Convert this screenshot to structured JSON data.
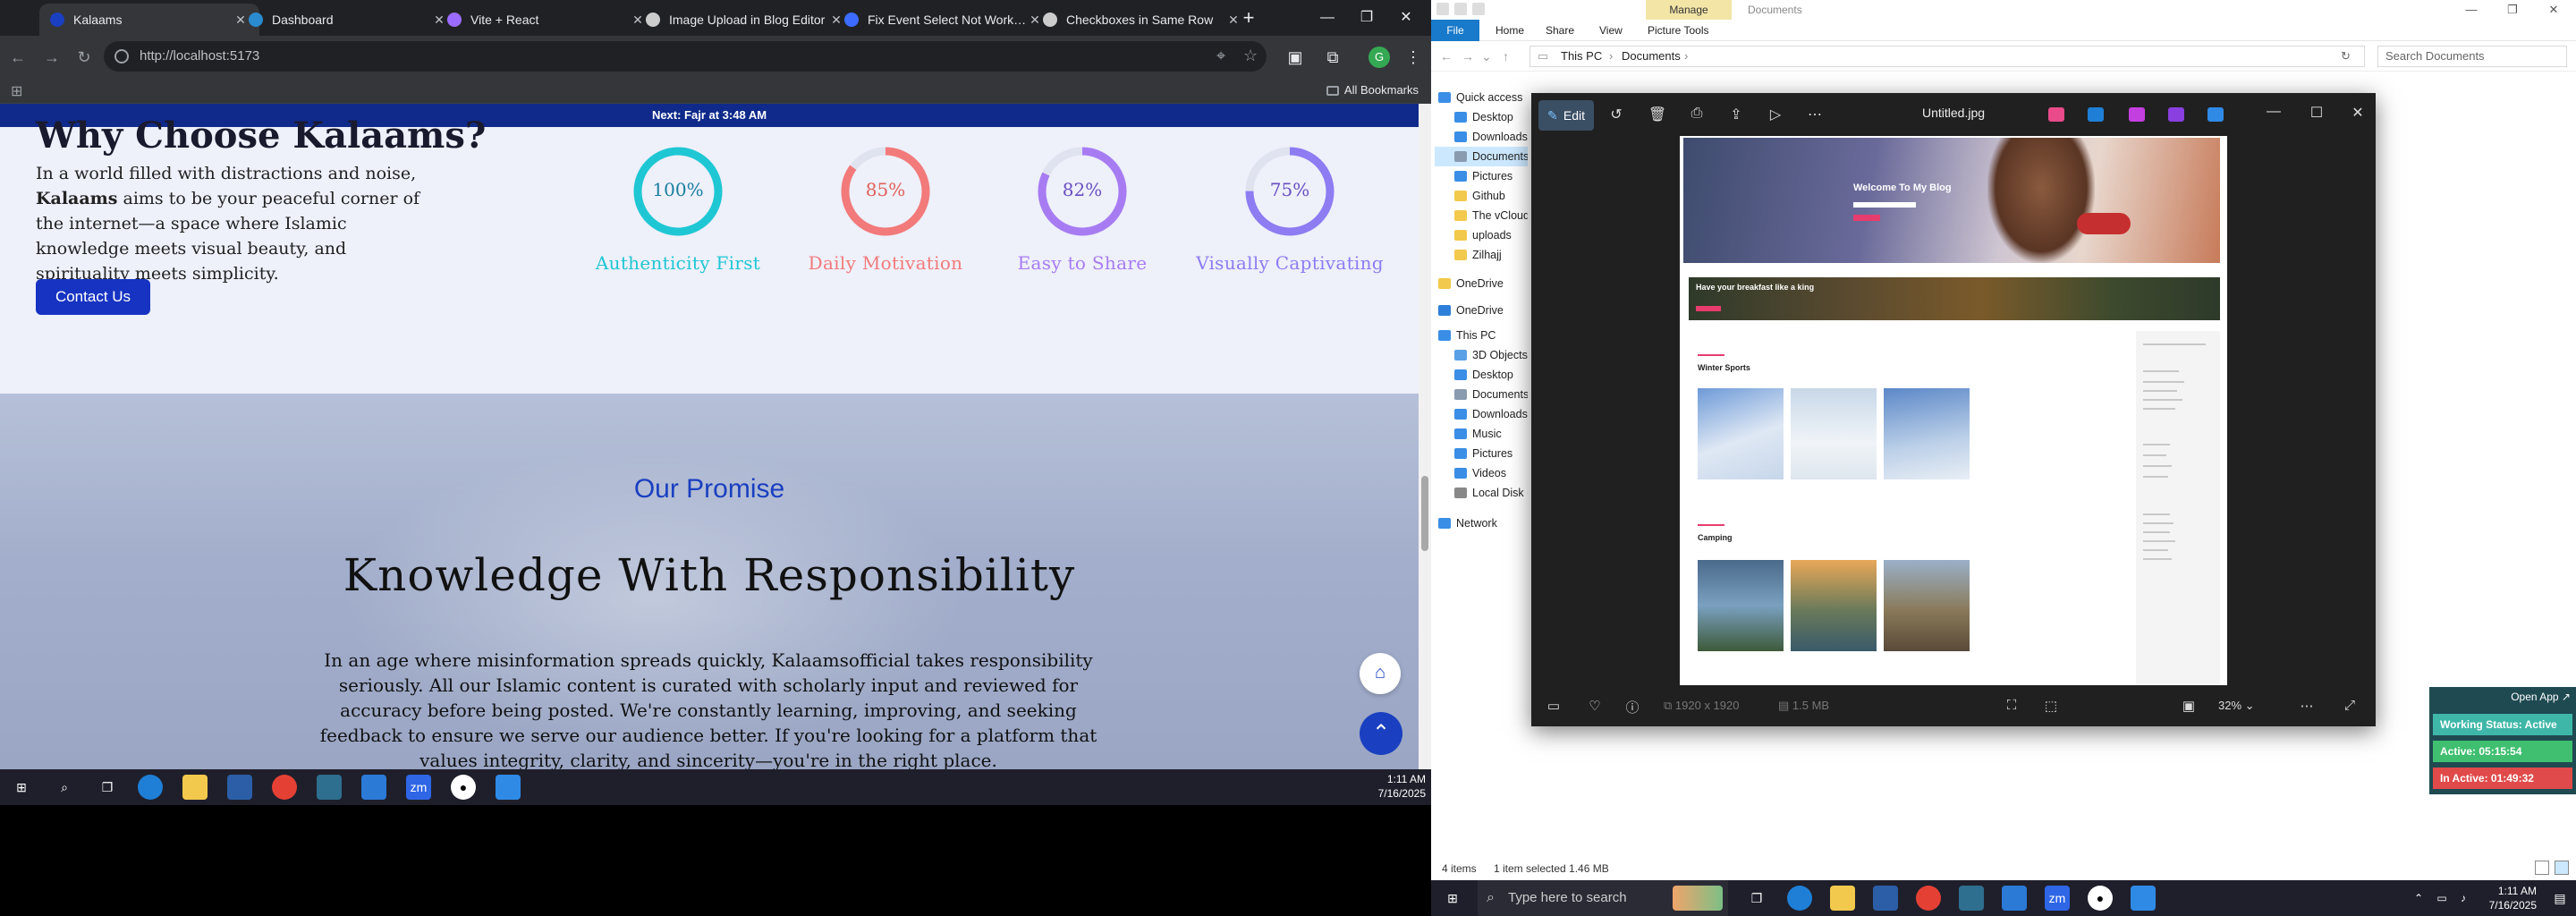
{
  "browser": {
    "tabs": [
      {
        "label": "Kalaams",
        "active": true,
        "favicon_color": "#1a3fc0"
      },
      {
        "label": "Dashboard",
        "active": false,
        "favicon_color": "#2a8bd0"
      },
      {
        "label": "Vite + React",
        "active": false,
        "favicon_color": "#9c6cff"
      },
      {
        "label": "Image Upload in Blog Editor",
        "active": false,
        "favicon_color": "#cccccc"
      },
      {
        "label": "Fix Event Select Not Working",
        "active": false,
        "favicon_color": "#3b6cff"
      },
      {
        "label": "Checkboxes in Same Row",
        "active": false,
        "favicon_color": "#cccccc"
      }
    ],
    "url": "http://localhost:5173",
    "profile_initial": "G",
    "all_bookmarks_label": "All Bookmarks"
  },
  "page": {
    "announcement": "Next: Fajr at 3:48 AM",
    "why_title": "Why Choose Kalaams?",
    "why_intro": "In a world filled with distractions and noise,",
    "why_brand": "Kalaams",
    "why_rest": " aims to be your peaceful corner of the internet—a space where Islamic knowledge meets visual beauty, and spirituality meets simplicity.",
    "contact_button": "Contact Us",
    "stats": [
      {
        "value_label": "100%",
        "value": 100,
        "caption": "Authenticity First",
        "color": "#1fc7d4",
        "text_color": "#1a7fa0"
      },
      {
        "value_label": "85%",
        "value": 85,
        "caption": "Daily Motivation",
        "color": "#f27a7a",
        "text_color": "#e0605a"
      },
      {
        "value_label": "82%",
        "value": 82,
        "caption": "Easy to Share",
        "color": "#a77cf2",
        "text_color": "#6a4fc0"
      },
      {
        "value_label": "75%",
        "value": 75,
        "caption": "Visually Captivating",
        "color": "#8d7cf2",
        "text_color": "#6a4fc0"
      }
    ],
    "promise_subtitle": "Our Promise",
    "promise_title": "Knowledge With Responsibility",
    "promise_text": "In an age where misinformation spreads quickly, Kalaamsofficial takes responsibility seriously. All our Islamic content is curated with scholarly input and reviewed for accuracy before being posted. We're constantly learning, improving, and seeking feedback to ensure we serve our audience better. If you're looking for a platform that values integrity, clarity, and sincerity—you're in the right place."
  },
  "taskbar_left": {
    "time": "1:11 AM",
    "date": "7/16/2025"
  },
  "explorer": {
    "manage_tab": "Manage",
    "window_title": "Documents",
    "ribbon_tabs": [
      "File",
      "Home",
      "Share",
      "View",
      "Picture Tools"
    ],
    "breadcrumb": [
      "This PC",
      "Documents"
    ],
    "search_placeholder": "Search Documents",
    "nav_items": [
      {
        "label": "Quick access",
        "icon_color": "#3a8ee6"
      },
      {
        "label": "Desktop",
        "icon_color": "#3a8ee6"
      },
      {
        "label": "Downloads",
        "icon_color": "#3a8ee6"
      },
      {
        "label": "Documents",
        "icon_color": "#8a9bb0"
      },
      {
        "label": "Pictures",
        "icon_color": "#3a8ee6"
      },
      {
        "label": "Github",
        "icon_color": "#f2c94c"
      },
      {
        "label": "The vCloud",
        "icon_color": "#f2c94c"
      },
      {
        "label": "uploads",
        "icon_color": "#f2c94c"
      },
      {
        "label": "Zilhajj",
        "icon_color": "#f2c94c"
      },
      {
        "label": "OneDrive",
        "icon_color": "#f2c94c"
      },
      {
        "label": "OneDrive",
        "icon_color": "#2e7fd9"
      },
      {
        "label": "This PC",
        "icon_color": "#3a8ee6"
      },
      {
        "label": "3D Objects",
        "icon_color": "#5aa0e6"
      },
      {
        "label": "Desktop",
        "icon_color": "#3a8ee6"
      },
      {
        "label": "Documents",
        "icon_color": "#8a9bb0"
      },
      {
        "label": "Downloads",
        "icon_color": "#3a8ee6"
      },
      {
        "label": "Music",
        "icon_color": "#3a8ee6"
      },
      {
        "label": "Pictures",
        "icon_color": "#3a8ee6"
      },
      {
        "label": "Videos",
        "icon_color": "#3a8ee6"
      },
      {
        "label": "Local Disk (C:)",
        "icon_color": "#888888"
      },
      {
        "label": "Network",
        "icon_color": "#3a8ee6"
      }
    ],
    "status_items": "4 items",
    "status_selected": "1 item selected  1.46 MB"
  },
  "photos": {
    "edit_label": "Edit",
    "file_name": "Untitled.jpg",
    "dimensions": "1920 x 1920",
    "file_size": "1.5 MB",
    "zoom": "32%",
    "preview": {
      "hero_text": "Welcome To My Blog",
      "band_text": "Have your breakfast like a king",
      "section1": "Winter Sports",
      "section2": "Camping"
    }
  },
  "status_widget": {
    "open_app": "Open App ↗",
    "working_status": "Working Status: Active",
    "active_time": "Active: 05:15:54",
    "inactive_time": "In Active: 01:49:32",
    "colors": {
      "working": "#3fb7a8",
      "active": "#3fbf6f",
      "inactive": "#e04a4a"
    }
  },
  "taskbar_right": {
    "search_placeholder": "Type here to search",
    "time": "1:11 AM",
    "date": "7/16/2025"
  }
}
